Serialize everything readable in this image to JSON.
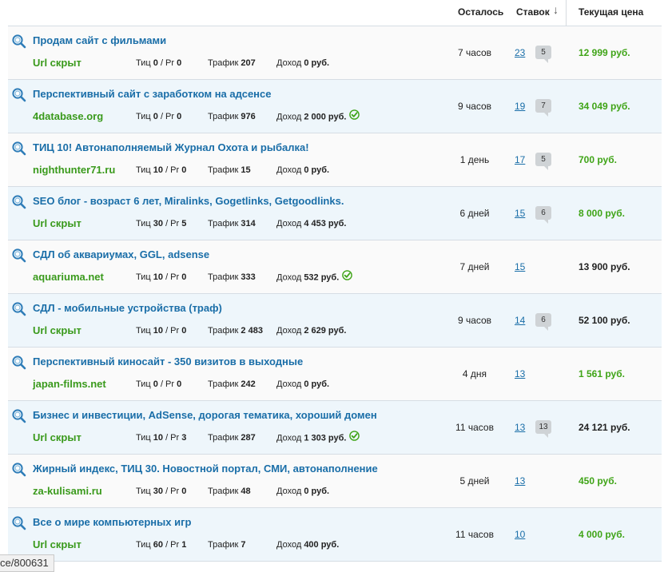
{
  "header": {
    "remaining": "Осталось",
    "bids": "Ставок",
    "bids_sort_icon": "arrow-down",
    "price": "Текущая цена"
  },
  "labels": {
    "tic": "Тиц",
    "pr_sep": "/ Pr",
    "traffic": "Трафик",
    "income": "Доход",
    "rub": "руб."
  },
  "colors": {
    "title": "#1a6ea8",
    "domain": "#3a9a1c",
    "price_green": "#3fa417",
    "alt_row": "#eef6fb"
  },
  "rows": [
    {
      "title": "Продам сайт с фильмами",
      "domain": "Url скрыт",
      "tic": "0",
      "pr": "0",
      "traffic": "207",
      "income": "0",
      "verified": false,
      "remaining": "7 часов",
      "bids": "23",
      "bubble": "5",
      "price": "12 999 руб.",
      "price_color": "green"
    },
    {
      "title": "Перспективный сайт с заработком на адсенсе",
      "domain": "4database.org",
      "tic": "0",
      "pr": "0",
      "traffic": "976",
      "income": "2 000",
      "verified": true,
      "remaining": "9 часов",
      "bids": "19",
      "bubble": "7",
      "price": "34 049 руб.",
      "price_color": "green"
    },
    {
      "title": "ТИЦ 10! Автонаполняемый Журнал Охота и рыбалка!",
      "domain": "nighthunter71.ru",
      "tic": "10",
      "pr": "0",
      "traffic": "15",
      "income": "0",
      "verified": false,
      "remaining": "1 день",
      "bids": "17",
      "bubble": "5",
      "price": "700 руб.",
      "price_color": "green"
    },
    {
      "title": "SEO блог - возраст 6 лет, Miralinks, Gogetlinks, Getgoodlinks.",
      "domain": "Url скрыт",
      "tic": "30",
      "pr": "5",
      "traffic": "314",
      "income": "4 453",
      "verified": false,
      "remaining": "6 дней",
      "bids": "15",
      "bubble": "6",
      "price": "8 000 руб.",
      "price_color": "green"
    },
    {
      "title": "СДЛ об аквариумах, GGL, adsense",
      "domain": "aquariuma.net",
      "tic": "10",
      "pr": "0",
      "traffic": "333",
      "income": "532",
      "verified": true,
      "remaining": "7 дней",
      "bids": "15",
      "bubble": "",
      "price": "13 900 руб.",
      "price_color": "black"
    },
    {
      "title": "СДЛ - мобильные устройства (траф)",
      "domain": "Url скрыт",
      "tic": "10",
      "pr": "0",
      "traffic": "2 483",
      "income": "2 629",
      "verified": false,
      "remaining": "9 часов",
      "bids": "14",
      "bubble": "6",
      "price": "52 100 руб.",
      "price_color": "black"
    },
    {
      "title": "Перспективный киносайт - 350 визитов в выходные",
      "domain": "japan-films.net",
      "tic": "0",
      "pr": "0",
      "traffic": "242",
      "income": "0",
      "verified": false,
      "remaining": "4 дня",
      "bids": "13",
      "bubble": "",
      "price": "1 561 руб.",
      "price_color": "green"
    },
    {
      "title": "Бизнес и инвестиции, AdSense, дорогая тематика, хороший домен",
      "domain": "Url скрыт",
      "tic": "10",
      "pr": "3",
      "traffic": "287",
      "income": "1 303",
      "verified": true,
      "remaining": "11 часов",
      "bids": "13",
      "bubble": "13",
      "price": "24 121 руб.",
      "price_color": "black"
    },
    {
      "title": "Жирный индекс, ТИЦ 30. Новостной портал, СМИ, автонаполнение",
      "domain": "za-kulisami.ru",
      "tic": "30",
      "pr": "0",
      "traffic": "48",
      "income": "0",
      "verified": false,
      "remaining": "5 дней",
      "bids": "13",
      "bubble": "",
      "price": "450 руб.",
      "price_color": "green"
    },
    {
      "title": "Все о мире компьютерных игр",
      "domain": "Url скрыт",
      "tic": "60",
      "pr": "1",
      "traffic": "7",
      "income": "400",
      "verified": false,
      "remaining": "11 часов",
      "bids": "10",
      "bubble": "",
      "price": "4 000 руб.",
      "price_color": "green"
    }
  ],
  "statusbar": {
    "text": "ce/800631"
  }
}
